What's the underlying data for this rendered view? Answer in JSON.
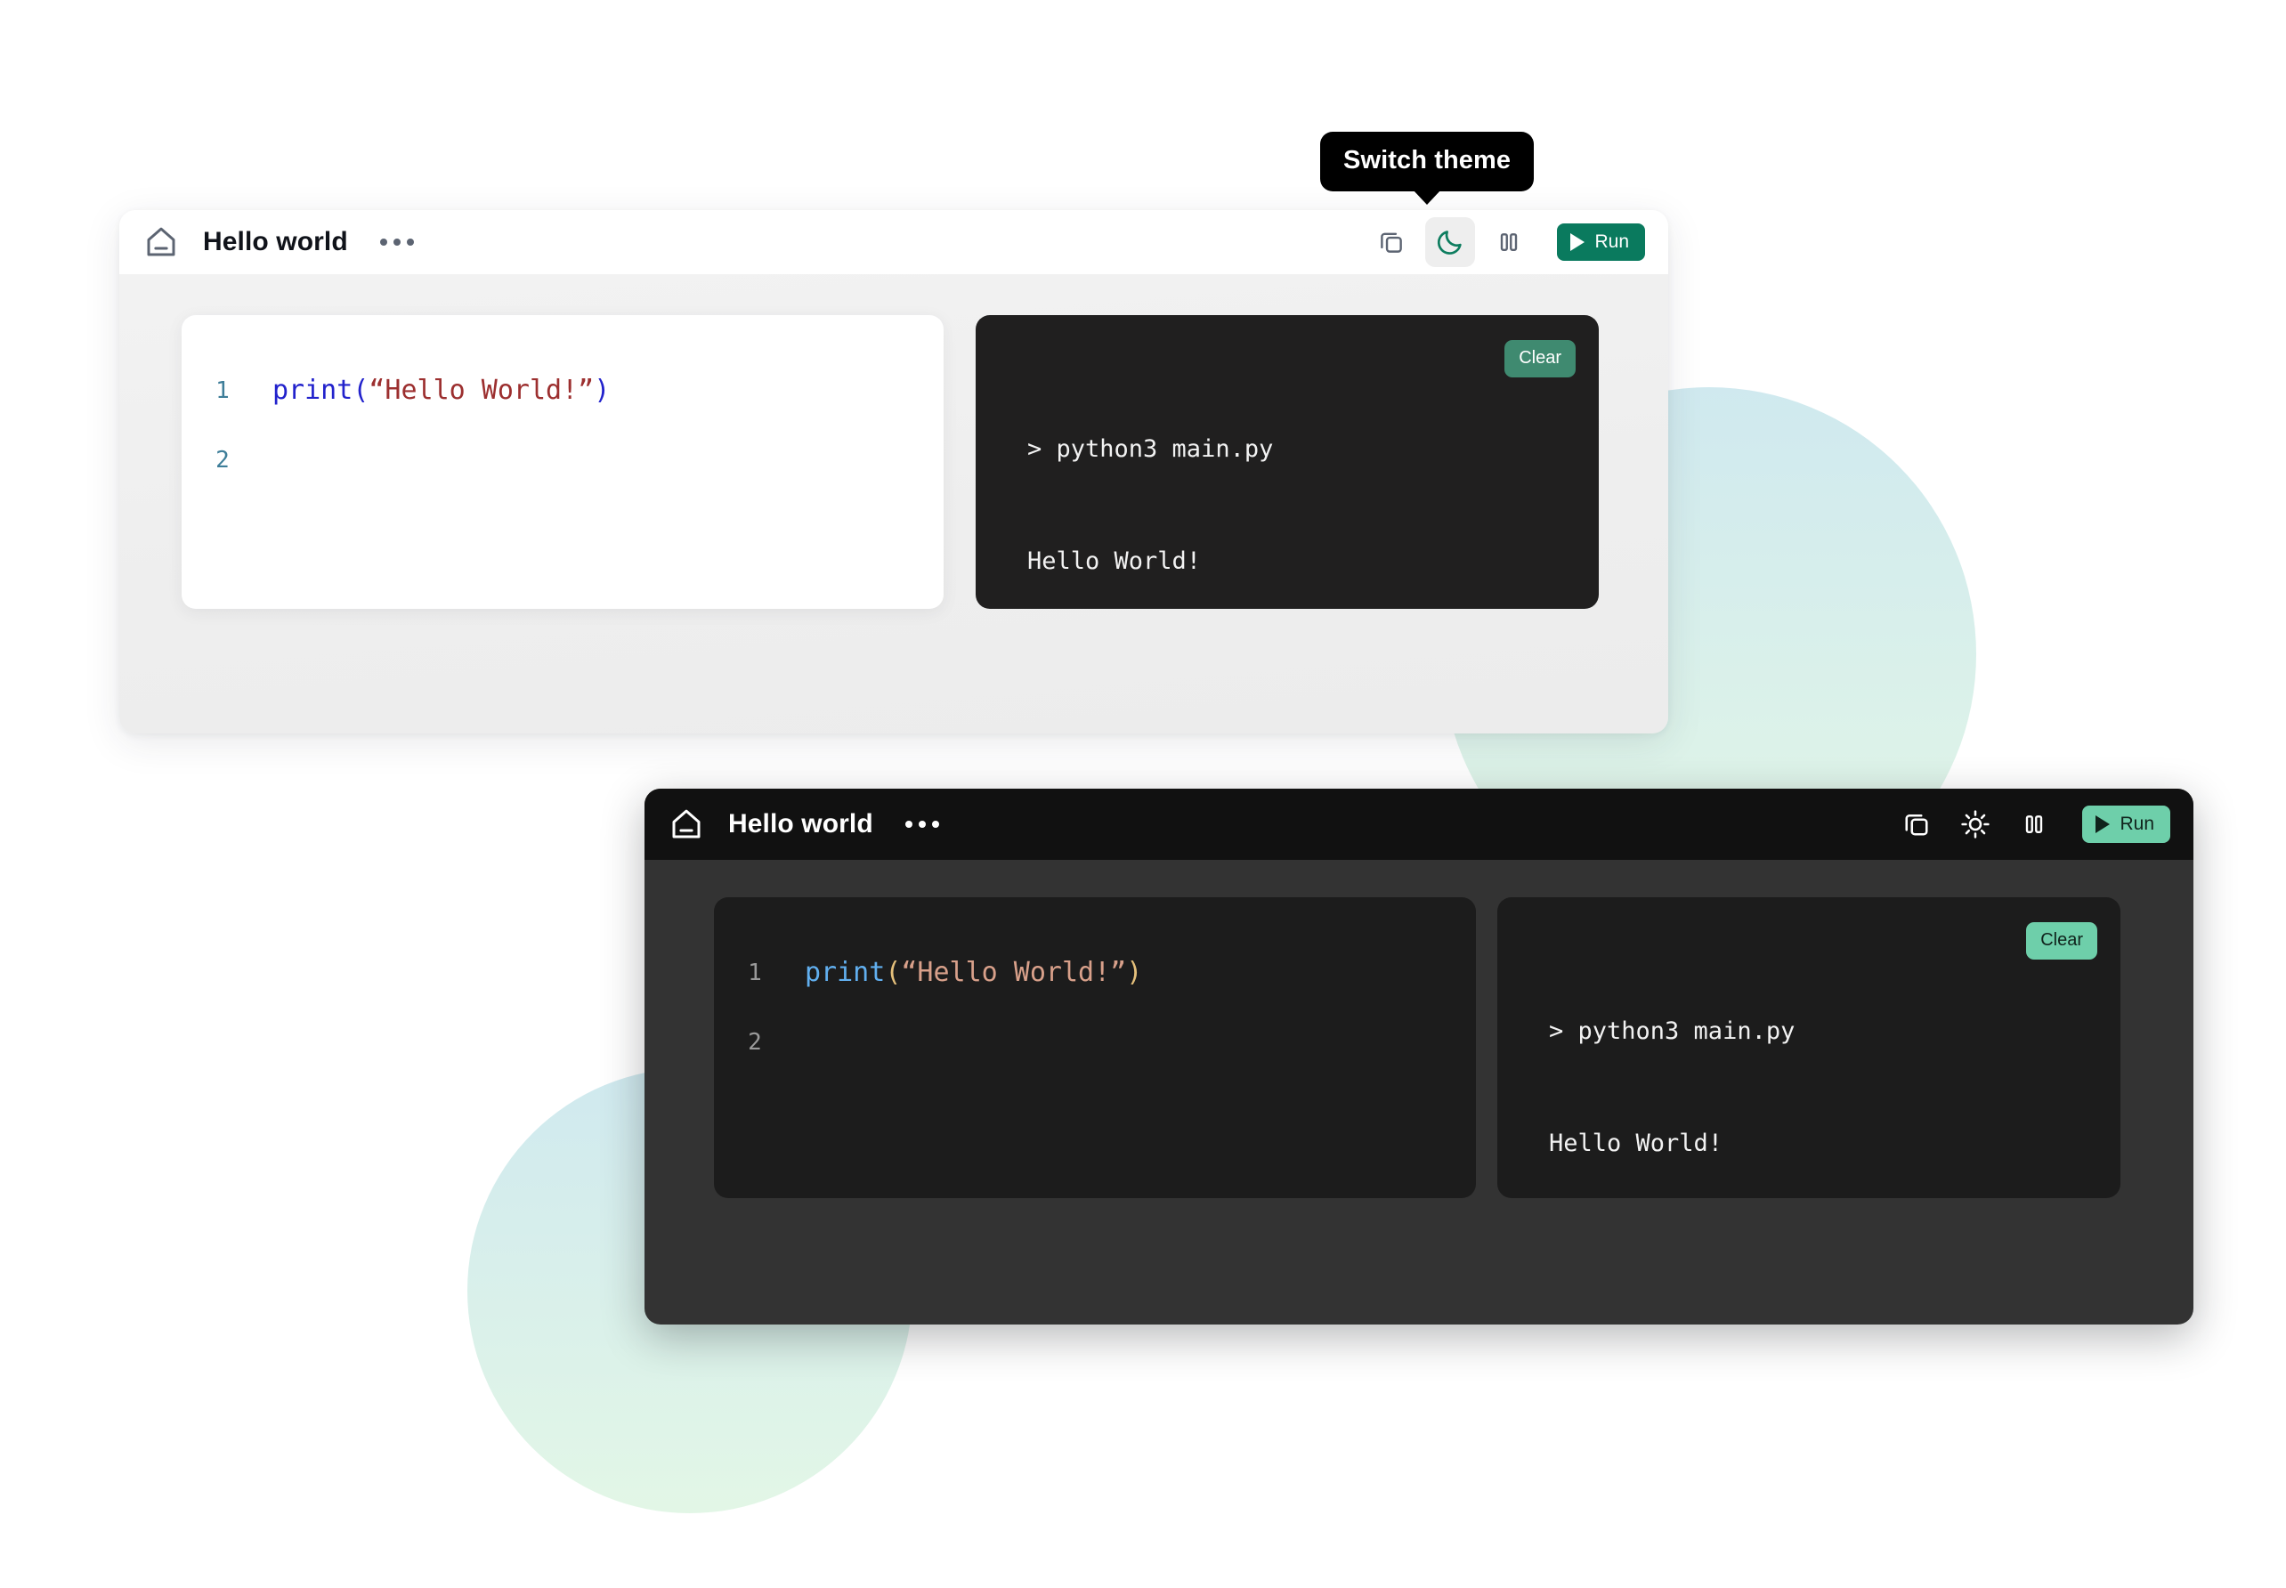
{
  "tooltip": {
    "text": "Switch theme"
  },
  "light_window": {
    "title": "Hello world",
    "home_icon": "home-icon",
    "menu_icon": "ellipsis-icon",
    "toolbar": {
      "copy_label": "copy-icon",
      "theme_label": "moon-icon",
      "layout_label": "split-panel-icon",
      "run_label": "Run",
      "run_bg": "#0a7a5e",
      "run_fg": "#ffffff"
    },
    "editor": {
      "line_numbers": [
        "1",
        "2"
      ],
      "code_fn": "print",
      "code_open": "(",
      "code_string": "“Hello World!”",
      "code_close": ")",
      "fn_color": "#2222cc",
      "string_color": "#9c2f2f",
      "paren_color": "#2222cc"
    },
    "terminal": {
      "clear_label": "Clear",
      "clear_bg": "#3f8a70",
      "lines": [
        "> python3 main.py",
        "Hello World!",
        ">"
      ]
    }
  },
  "dark_window": {
    "title": "Hello world",
    "home_icon": "home-icon",
    "menu_icon": "ellipsis-icon",
    "toolbar": {
      "copy_label": "copy-icon",
      "theme_label": "sun-icon",
      "layout_label": "split-panel-icon",
      "run_label": "Run",
      "run_bg": "#6ecfaa",
      "run_fg": "#10231c"
    },
    "editor": {
      "line_numbers": [
        "1",
        "2"
      ],
      "code_fn": "print",
      "code_open": "(",
      "code_string": "“Hello World!”",
      "code_close": ")",
      "fn_color": "#61afef",
      "string_color": "#d8a08a",
      "paren_color": "#e5c07b"
    },
    "terminal": {
      "clear_label": "Clear",
      "clear_bg": "#6ecfaa",
      "lines": [
        "> python3 main.py",
        "Hello World!",
        ">"
      ]
    }
  },
  "decoration": {
    "blob_top_color": "#cde8ee",
    "blob_bottom_color": "#e1f6e5"
  }
}
